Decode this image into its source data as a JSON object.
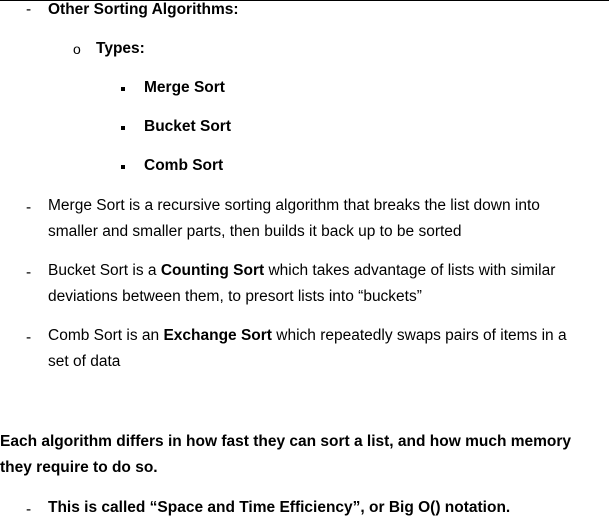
{
  "heading": {
    "marker": "-",
    "text": "Other Sorting Algorithms:"
  },
  "types": {
    "marker": "o",
    "label": "Types:",
    "items": [
      "Merge Sort",
      "Bucket Sort",
      "Comb Sort"
    ]
  },
  "descriptions": [
    {
      "marker": "-",
      "line1_pre": "Merge Sort is a recursive sorting algorithm that breaks the list down into",
      "line2": "smaller and smaller parts, then builds it back up to be sorted"
    },
    {
      "marker": "-",
      "line1_pre": "Bucket Sort is a ",
      "line1_bold": "Counting Sort",
      "line1_post": " which takes advantage of lists with similar",
      "line2": "deviations between them, to presort lists into “buckets”"
    },
    {
      "marker": "-",
      "line1_pre": "Comb Sort is an ",
      "line1_bold": "Exchange Sort",
      "line1_post": " which repeatedly swaps pairs of items in a",
      "line2": "set of data"
    }
  ],
  "summary": {
    "line1": "Each algorithm differs in how fast they can sort a list, and how much memory",
    "line2": "they require to do so."
  },
  "final_point": {
    "marker": "-",
    "text": "This is called “Space and Time Efficiency”, or Big O() notation."
  }
}
